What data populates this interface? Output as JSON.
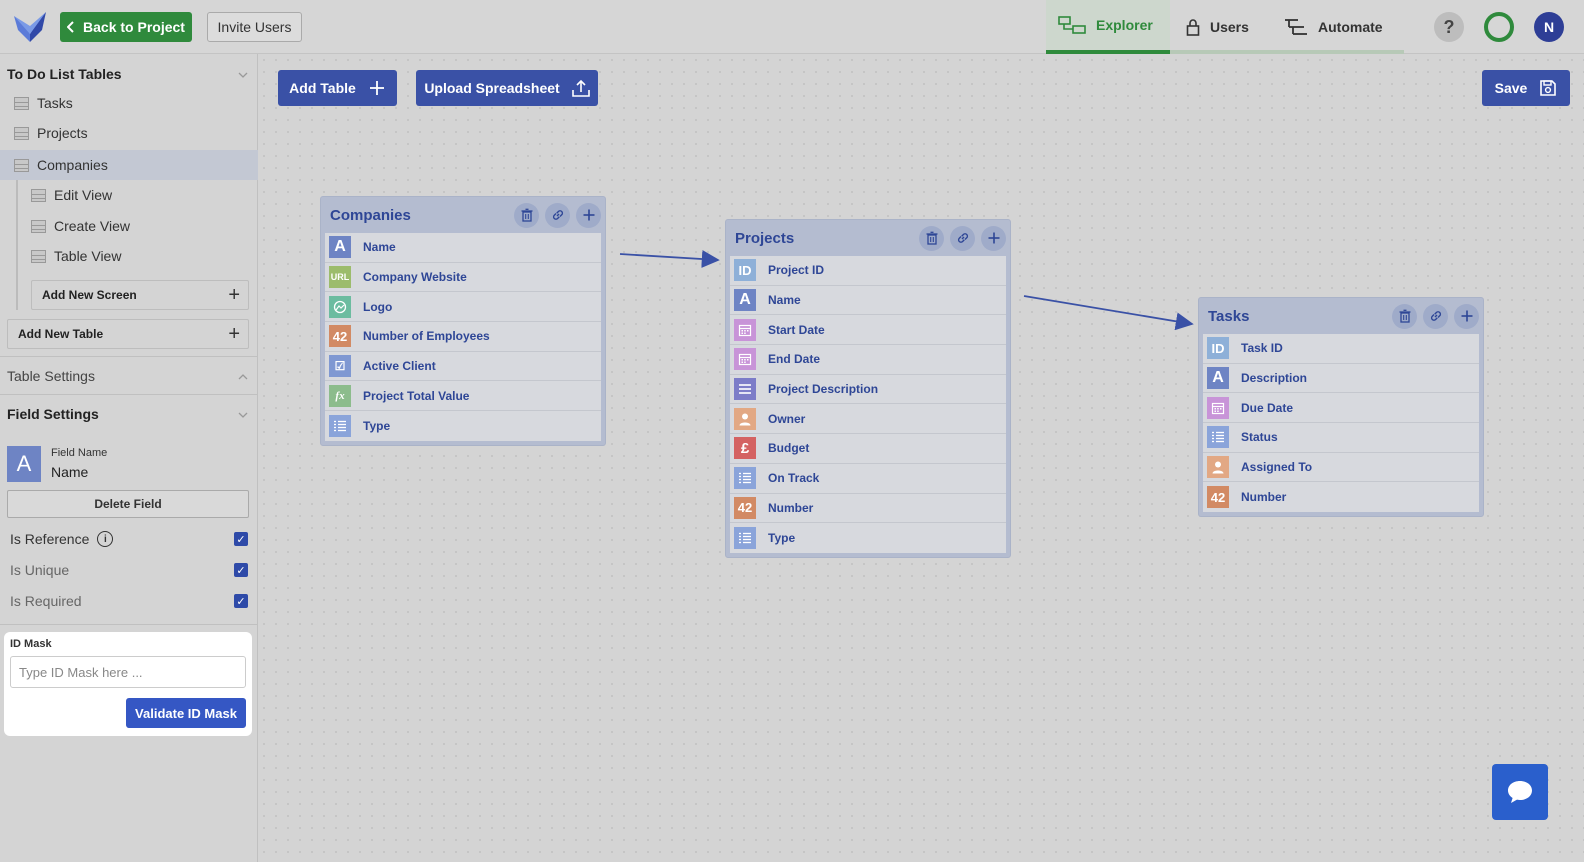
{
  "topbar": {
    "back_label": "Back to Project",
    "invite_label": "Invite Users",
    "tabs": [
      {
        "label": "Explorer",
        "icon": "explorer-icon"
      },
      {
        "label": "Users",
        "icon": "lock-icon"
      },
      {
        "label": "Automate",
        "icon": "automate-icon"
      }
    ],
    "help_label": "?",
    "avatar_initial": "N"
  },
  "sidebar": {
    "section_title": "To Do List Tables",
    "tables": [
      {
        "label": "Tasks"
      },
      {
        "label": "Projects"
      },
      {
        "label": "Companies"
      }
    ],
    "views": [
      {
        "label": "Edit View"
      },
      {
        "label": "Create View"
      },
      {
        "label": "Table View"
      }
    ],
    "add_screen_label": "Add New Screen",
    "add_table_label": "Add New Table",
    "table_settings_label": "Table Settings",
    "field_settings_label": "Field Settings",
    "field": {
      "icon_letter": "A",
      "name_label": "Field Name",
      "name_value": "Name"
    },
    "delete_field_label": "Delete Field",
    "checks": [
      {
        "label": "Is Reference",
        "checked": true
      },
      {
        "label": "Is Unique",
        "checked": true
      },
      {
        "label": "Is Required",
        "checked": true
      }
    ],
    "id_mask": {
      "label": "ID Mask",
      "placeholder": "Type ID Mask here ...",
      "value": "",
      "validate_label": "Validate ID Mask"
    }
  },
  "canvas": {
    "add_table_label": "Add Table",
    "upload_label": "Upload Spreadsheet",
    "save_label": "Save",
    "tables": [
      {
        "title": "Companies",
        "fields": [
          {
            "type": "text",
            "glyph": "A",
            "name": "Name"
          },
          {
            "type": "url",
            "glyph": "URL",
            "name": "Company Website"
          },
          {
            "type": "image",
            "glyph": "",
            "name": "Logo"
          },
          {
            "type": "number",
            "glyph": "42",
            "name": "Number of Employees"
          },
          {
            "type": "bool",
            "glyph": "☑",
            "name": "Active Client"
          },
          {
            "type": "formula",
            "glyph": "fx",
            "name": "Project Total Value"
          },
          {
            "type": "list",
            "glyph": "",
            "name": "Type"
          }
        ]
      },
      {
        "title": "Projects",
        "fields": [
          {
            "type": "id",
            "glyph": "ID",
            "name": "Project ID"
          },
          {
            "type": "text",
            "glyph": "A",
            "name": "Name"
          },
          {
            "type": "date",
            "glyph": "",
            "name": "Start Date"
          },
          {
            "type": "date",
            "glyph": "",
            "name": "End Date"
          },
          {
            "type": "longtext",
            "glyph": "",
            "name": "Project Description"
          },
          {
            "type": "user",
            "glyph": "",
            "name": "Owner"
          },
          {
            "type": "currency",
            "glyph": "£",
            "name": "Budget"
          },
          {
            "type": "list",
            "glyph": "",
            "name": "On Track"
          },
          {
            "type": "number",
            "glyph": "42",
            "name": "Number"
          },
          {
            "type": "list",
            "glyph": "",
            "name": "Type"
          }
        ]
      },
      {
        "title": "Tasks",
        "fields": [
          {
            "type": "id",
            "glyph": "ID",
            "name": "Task ID"
          },
          {
            "type": "text",
            "glyph": "A",
            "name": "Description"
          },
          {
            "type": "date",
            "glyph": "",
            "name": "Due Date"
          },
          {
            "type": "list",
            "glyph": "",
            "name": "Status"
          },
          {
            "type": "user",
            "glyph": "",
            "name": "Assigned To"
          },
          {
            "type": "number",
            "glyph": "42",
            "name": "Number"
          }
        ]
      }
    ]
  },
  "colors": {
    "brand_green": "#2f8a3c",
    "primary_blue": "#3a51a6",
    "table_title_blue": "#2e4696"
  }
}
